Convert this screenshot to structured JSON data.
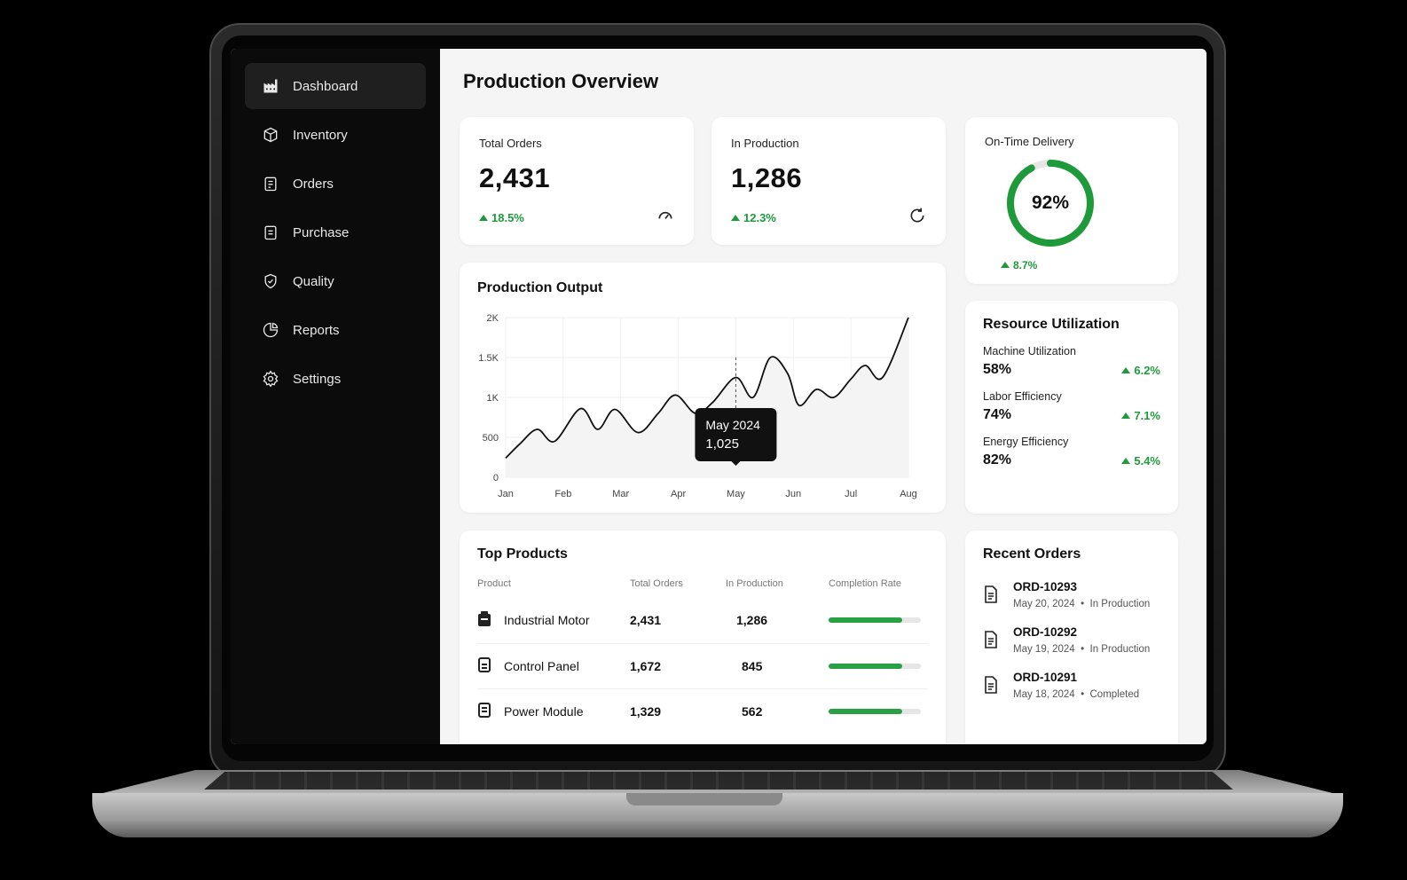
{
  "sidebar": {
    "items": [
      {
        "label": "Dashboard",
        "icon": "factory-icon",
        "active": true
      },
      {
        "label": "Inventory",
        "icon": "box-icon"
      },
      {
        "label": "Orders",
        "icon": "clipboard-icon"
      },
      {
        "label": "Purchase",
        "icon": "receipt-icon"
      },
      {
        "label": "Quality",
        "icon": "shield-check-icon"
      },
      {
        "label": "Reports",
        "icon": "pie-chart-icon"
      },
      {
        "label": "Settings",
        "icon": "gear-icon"
      }
    ]
  },
  "header": {
    "title": "Production Overview"
  },
  "kpis": {
    "total_orders": {
      "label": "Total Orders",
      "value": "2,431",
      "delta": "18.5%"
    },
    "in_production": {
      "label": "In Production",
      "value": "1,286",
      "delta": "12.3%"
    },
    "on_time": {
      "label": "On-Time Delivery",
      "value": "92%",
      "percent": 92,
      "delta": "8.7%"
    }
  },
  "colors": {
    "accent_green": "#1f9a3b",
    "sidebar_bg": "#0b0b0b"
  },
  "chart_data": {
    "type": "line",
    "title": "Production Output",
    "x": [
      "Jan",
      "Feb",
      "Mar",
      "Apr",
      "May",
      "Jun",
      "Jul",
      "Aug"
    ],
    "y_ticks": [
      "0",
      "500",
      "1K",
      "1.5K",
      "2K"
    ],
    "ylim": [
      0,
      2000
    ],
    "series": [
      {
        "points": [
          [
            0,
            240
          ],
          [
            0.25,
            420
          ],
          [
            0.55,
            600
          ],
          [
            0.85,
            450
          ],
          [
            1.3,
            860
          ],
          [
            1.6,
            600
          ],
          [
            1.9,
            850
          ],
          [
            2.3,
            560
          ],
          [
            2.65,
            800
          ],
          [
            2.95,
            1030
          ],
          [
            3.3,
            800
          ],
          [
            3.6,
            940
          ],
          [
            4.0,
            1250
          ],
          [
            4.3,
            1000
          ],
          [
            4.6,
            1500
          ],
          [
            4.9,
            1300
          ],
          [
            5.1,
            900
          ],
          [
            5.4,
            1100
          ],
          [
            5.7,
            1000
          ],
          [
            6.0,
            1230
          ],
          [
            6.25,
            1400
          ],
          [
            6.55,
            1250
          ],
          [
            7.0,
            2000
          ]
        ]
      }
    ],
    "tooltip": {
      "label": "May 2024",
      "value": "1,025"
    },
    "grid": true
  },
  "resources": {
    "title": "Resource Utilization",
    "items": [
      {
        "name": "Machine Utilization",
        "value": "58%",
        "delta": "6.2%"
      },
      {
        "name": "Labor Efficiency",
        "value": "74%",
        "delta": "7.1%"
      },
      {
        "name": "Energy Efficiency",
        "value": "82%",
        "delta": "5.4%"
      }
    ]
  },
  "top_products": {
    "title": "Top Products",
    "columns": [
      "Product",
      "Total Orders",
      "In Production",
      "Completion Rate"
    ],
    "rows": [
      {
        "product": "Industrial Motor",
        "total": "2,431",
        "in_prod": "1,286",
        "completion": 0.8
      },
      {
        "product": "Control Panel",
        "total": "1,672",
        "in_prod": "845",
        "completion": 0.8
      },
      {
        "product": "Power Module",
        "total": "1,329",
        "in_prod": "562",
        "completion": 0.8
      }
    ]
  },
  "recent_orders": {
    "title": "Recent Orders",
    "items": [
      {
        "id": "ORD-10293",
        "date": "May 20, 2024",
        "status": "In Production"
      },
      {
        "id": "ORD-10292",
        "date": "May 19, 2024",
        "status": "In Production"
      },
      {
        "id": "ORD-10291",
        "date": "May 18, 2024",
        "status": "Completed"
      }
    ]
  }
}
